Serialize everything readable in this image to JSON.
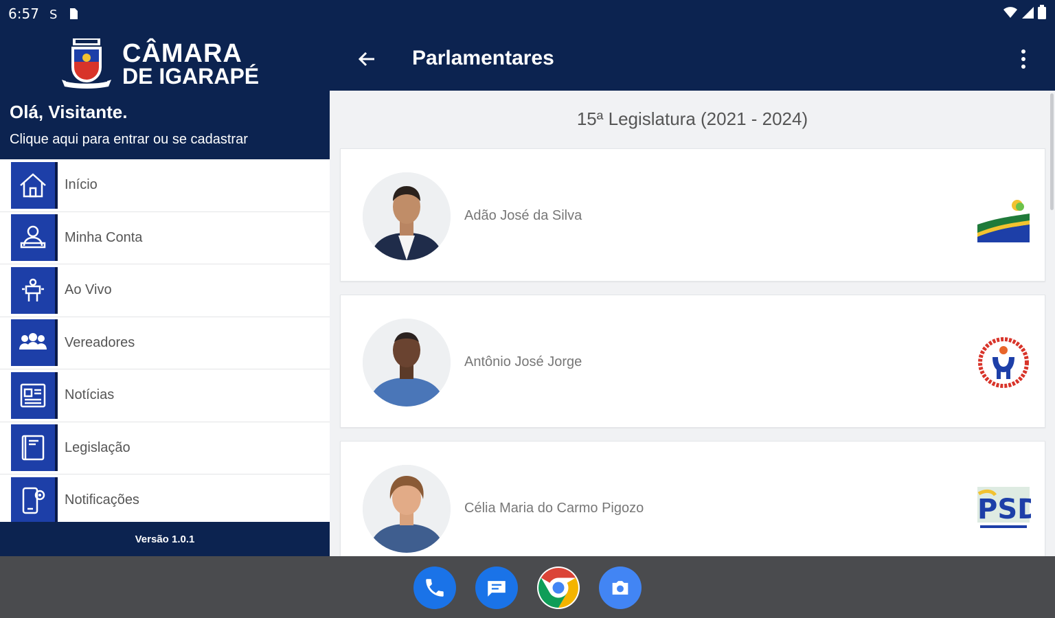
{
  "status_bar": {
    "time": "6:57",
    "icons": [
      "s-icon",
      "sim-icon"
    ],
    "right_icons": [
      "wifi-icon",
      "signal-icon",
      "battery-icon"
    ]
  },
  "drawer": {
    "logo_line1": "CÂMARA",
    "logo_line2": "DE IGARAPÉ",
    "greeting": "Olá, Visitante.",
    "login_hint": "Clique aqui para entrar ou se cadastrar",
    "items": [
      {
        "label": "Início",
        "icon": "home-icon"
      },
      {
        "label": "Minha Conta",
        "icon": "account-icon"
      },
      {
        "label": "Ao Vivo",
        "icon": "live-icon"
      },
      {
        "label": "Vereadores",
        "icon": "group-icon"
      },
      {
        "label": "Notícias",
        "icon": "news-icon"
      },
      {
        "label": "Legislação",
        "icon": "book-icon"
      },
      {
        "label": "Notificações",
        "icon": "notification-icon"
      }
    ],
    "version": "Versão 1.0.1"
  },
  "appbar": {
    "title": "Parlamentares"
  },
  "content": {
    "legislatura": "15ª Legislatura (2021 - 2024)",
    "parlamentares": [
      {
        "name": "Adão José da Silva",
        "party_logo": "republicanos-logo"
      },
      {
        "name": "Antônio José Jorge",
        "party_logo": "pp-logo"
      },
      {
        "name": "Célia Maria do Carmo Pigozo",
        "party_logo": "psd-logo"
      }
    ]
  },
  "taskbar": {
    "apps": [
      "phone-icon",
      "messages-icon",
      "chrome-icon",
      "camera-icon"
    ]
  },
  "colors": {
    "primary": "#0c2350",
    "menu_icon_bg": "#1d3fa8",
    "taskbar": "#4a4b4e"
  }
}
